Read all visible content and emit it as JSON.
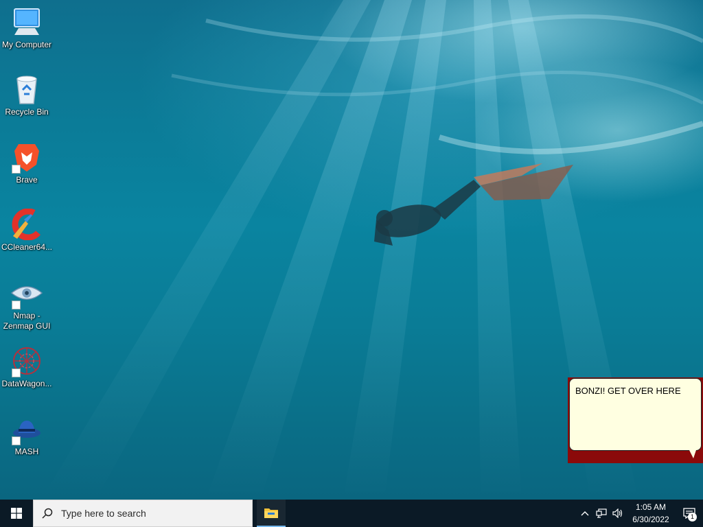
{
  "desktop": {
    "icons": [
      {
        "label": "My Computer",
        "icon": "monitor-icon",
        "shortcut": false
      },
      {
        "label": "Recycle Bin",
        "icon": "recycle-bin-icon",
        "shortcut": false
      },
      {
        "label": "Brave",
        "icon": "brave-lion-icon",
        "shortcut": true
      },
      {
        "label": "CCleaner64...",
        "icon": "ccleaner-icon",
        "shortcut": false
      },
      {
        "label": "Nmap -\nZenmap GUI",
        "icon": "nmap-eye-icon",
        "shortcut": true
      },
      {
        "label": "DataWagon...",
        "icon": "datawagon-icon",
        "shortcut": true
      },
      {
        "label": "MASH",
        "icon": "mash-hat-icon",
        "shortcut": true
      }
    ]
  },
  "balloon": {
    "text": "BONZI! GET OVER HERE",
    "background": "#ffffe1",
    "frame_color": "#8b0a0a"
  },
  "taskbar": {
    "start_icon": "windows-logo-icon",
    "search_placeholder": "Type here to search",
    "pinned_apps": [
      {
        "icon": "file-explorer-icon"
      }
    ],
    "tray": {
      "icons": [
        "chevron-up-icon",
        "network-icon",
        "volume-icon"
      ],
      "time": "1:05 AM",
      "date": "6/30/2022",
      "notification_count": "1"
    },
    "background": "#0b1a26",
    "accent": "#76b9ed"
  }
}
